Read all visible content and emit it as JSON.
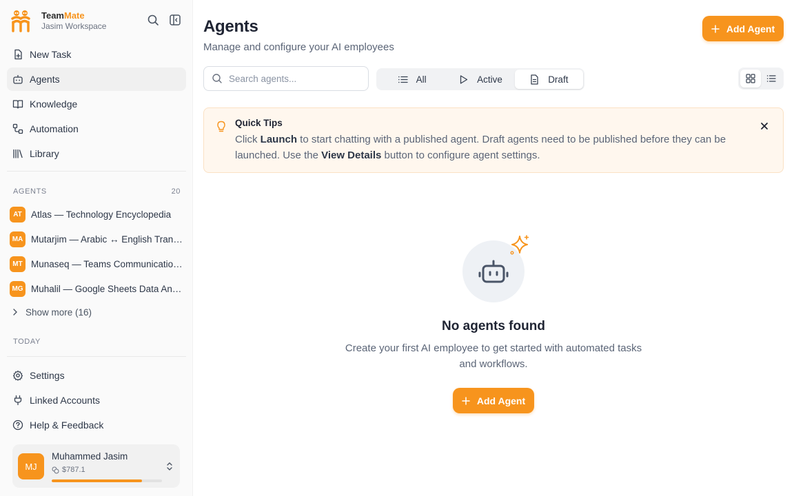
{
  "brand": {
    "name_prefix": "Team",
    "name_accent": "Mate",
    "workspace": "Jasim Workspace"
  },
  "sidebar": {
    "nav": [
      {
        "label": "New Task",
        "icon": "new-task-icon"
      },
      {
        "label": "Agents",
        "icon": "bot-icon",
        "active": true
      },
      {
        "label": "Knowledge",
        "icon": "book-icon"
      },
      {
        "label": "Automation",
        "icon": "workflow-icon"
      },
      {
        "label": "Library",
        "icon": "library-icon"
      }
    ],
    "agents_heading": "AGENTS",
    "agents_count": "20",
    "agents": [
      {
        "initials": "AT",
        "name": "Atlas — Technology Encyclopedia"
      },
      {
        "initials": "MA",
        "name": "Mutarjim — Arabic ↔ English Translator"
      },
      {
        "initials": "MT",
        "name": "Munaseq — Teams Communication Assistant"
      },
      {
        "initials": "MG",
        "name": "Muhalil — Google Sheets Data Analyst"
      }
    ],
    "show_more": "Show more (16)",
    "today_heading": "TODAY",
    "bottom_nav": [
      {
        "label": "Settings",
        "icon": "gear-icon"
      },
      {
        "label": "Linked Accounts",
        "icon": "plug-icon"
      },
      {
        "label": "Help & Feedback",
        "icon": "help-circle-icon"
      }
    ],
    "user": {
      "initials": "MJ",
      "name": "Muhammed Jasim",
      "credits": "$787.1",
      "credits_fraction": 0.82
    }
  },
  "main": {
    "title": "Agents",
    "subtitle": "Manage and configure your AI employees",
    "add_button": "Add Agent",
    "search_placeholder": "Search agents...",
    "filters": [
      {
        "label": "All",
        "icon": "list-icon"
      },
      {
        "label": "Active",
        "icon": "play-icon"
      },
      {
        "label": "Draft",
        "icon": "document-icon",
        "active": true
      }
    ],
    "view_modes": [
      "grid-view-icon",
      "list-view-icon"
    ],
    "tips": {
      "title": "Quick Tips",
      "part1": "Click ",
      "launch": "Launch",
      "part2": " to start chatting with a published agent. Draft agents need to be published before they can be launched. Use the ",
      "view_details": "View Details",
      "part3": " button to configure agent settings."
    },
    "empty": {
      "title": "No agents found",
      "description": "Create your first AI employee to get started with automated tasks and workflows.",
      "button": "Add Agent"
    }
  },
  "colors": {
    "accent": "#f7941d",
    "sidebar_bg": "#fafafa",
    "tips_bg": "#fff7ee",
    "text_dark": "#1f2433",
    "text_muted": "#5b6577"
  }
}
